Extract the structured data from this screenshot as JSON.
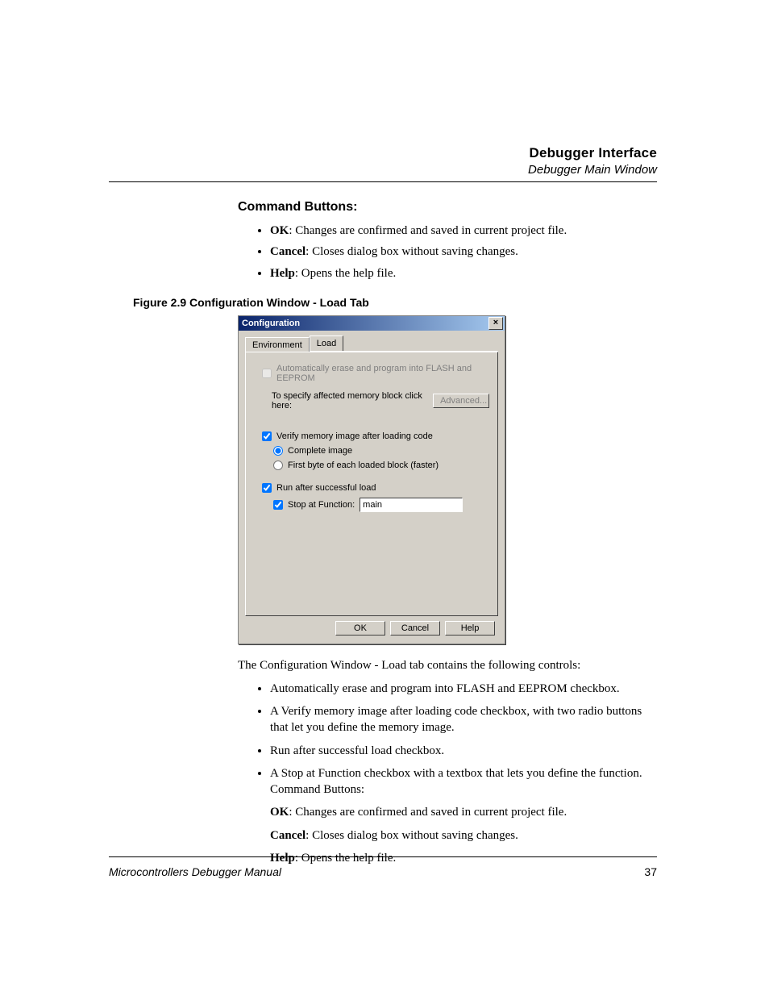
{
  "header": {
    "title": "Debugger Interface",
    "subtitle": "Debugger Main Window"
  },
  "section_heading": "Command Buttons:",
  "command_buttons": [
    {
      "name": "OK",
      "desc": ": Changes are confirmed and saved in current project file."
    },
    {
      "name": "Cancel",
      "desc": ": Closes dialog box without saving changes."
    },
    {
      "name": "Help",
      "desc": ": Opens the help file."
    }
  ],
  "figure_caption": "Figure 2.9  Configuration Window - Load Tab",
  "dialog": {
    "title": "Configuration",
    "close": "×",
    "tabs": {
      "environment": "Environment",
      "load": "Load"
    },
    "auto_erase": "Automatically erase and program into FLASH and EEPROM",
    "specify_label": "To specify affected memory block click here:",
    "advanced": "Advanced...",
    "verify": "Verify memory image after loading code",
    "radio_complete": "Complete image",
    "radio_firstbyte": "First byte of each loaded block (faster)",
    "run_after": "Run after successful load",
    "stop_at": "Stop at Function:",
    "stop_value": "main",
    "ok": "OK",
    "cancel": "Cancel",
    "help": "Help"
  },
  "desc_intro": "The Configuration Window - Load tab contains the following controls:",
  "desc_list": {
    "i0": "Automatically erase and program into FLASH and EEPROM checkbox.",
    "i1": "A Verify memory image after loading code checkbox, with two radio buttons that let you define the memory image.",
    "i2": "Run after successful load checkbox.",
    "i3_a": "A Stop at Function checkbox with a textbox that lets you define the function. Command Buttons:",
    "i3_ok_b": "OK",
    "i3_ok": ": Changes are confirmed and saved in current project file.",
    "i3_cancel_b": "Cancel",
    "i3_cancel": ": Closes dialog box without saving changes.",
    "i3_help_b": "Help",
    "i3_help": ": Opens the help file."
  },
  "footer": {
    "manual": "Microcontrollers Debugger Manual",
    "page": "37"
  }
}
